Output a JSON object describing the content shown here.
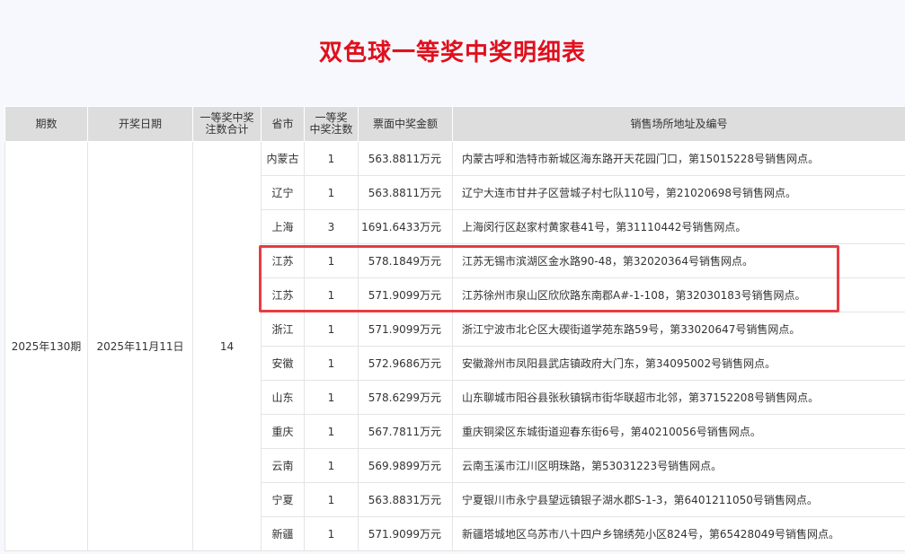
{
  "page": {
    "title": "双色球一等奖中奖明细表"
  },
  "table": {
    "headers": {
      "issue": "期数",
      "date": "开奖日期",
      "total_line1": "一等奖中奖",
      "total_line2": "注数合计",
      "province": "省市",
      "count_line1": "一等奖",
      "count_line2": "中奖注数",
      "amount": "票面中奖金额",
      "address": "销售场所地址及编号"
    },
    "issue": "2025年130期",
    "date": "2025年11月11日",
    "total": "14",
    "rows": [
      {
        "province": "内蒙古",
        "count": "1",
        "amount": "563.8811万元",
        "address": "内蒙古呼和浩特市新城区海东路开天花园门口，第15015228号销售网点。"
      },
      {
        "province": "辽宁",
        "count": "1",
        "amount": "563.8811万元",
        "address": "辽宁大连市甘井子区营城子村七队110号，第21020698号销售网点。"
      },
      {
        "province": "上海",
        "count": "3",
        "amount": "1691.6433万元",
        "address": "上海闵行区赵家村黄家巷41号，第31110442号销售网点。"
      },
      {
        "province": "江苏",
        "count": "1",
        "amount": "578.1849万元",
        "address": "江苏无锡市滨湖区金水路90-48，第32020364号销售网点。"
      },
      {
        "province": "江苏",
        "count": "1",
        "amount": "571.9099万元",
        "address": "江苏徐州市泉山区欣欣路东南郡A#-1-108，第32030183号销售网点。"
      },
      {
        "province": "浙江",
        "count": "1",
        "amount": "571.9099万元",
        "address": "浙江宁波市北仑区大碶街道学苑东路59号，第33020647号销售网点。"
      },
      {
        "province": "安徽",
        "count": "1",
        "amount": "572.9686万元",
        "address": "安徽滁州市凤阳县武店镇政府大门东，第34095002号销售网点。"
      },
      {
        "province": "山东",
        "count": "1",
        "amount": "578.6299万元",
        "address": "山东聊城市阳谷县张秋镇锅市街华联超市北邻，第37152208号销售网点。"
      },
      {
        "province": "重庆",
        "count": "1",
        "amount": "567.7811万元",
        "address": "重庆铜梁区东城街道迎春东街6号，第40210056号销售网点。"
      },
      {
        "province": "云南",
        "count": "1",
        "amount": "569.9899万元",
        "address": "云南玉溪市江川区明珠路，第53031223号销售网点。"
      },
      {
        "province": "宁夏",
        "count": "1",
        "amount": "563.8831万元",
        "address": "宁夏银川市永宁县望远镇银子湖水郡S-1-3，第6401211050号销售网点。"
      },
      {
        "province": "新疆",
        "count": "1",
        "amount": "571.9099万元",
        "address": "新疆塔城地区乌苏市八十四户乡锦绣苑小区824号，第65428049号销售网点。"
      }
    ]
  },
  "highlight": {
    "color": "#e83b42"
  }
}
